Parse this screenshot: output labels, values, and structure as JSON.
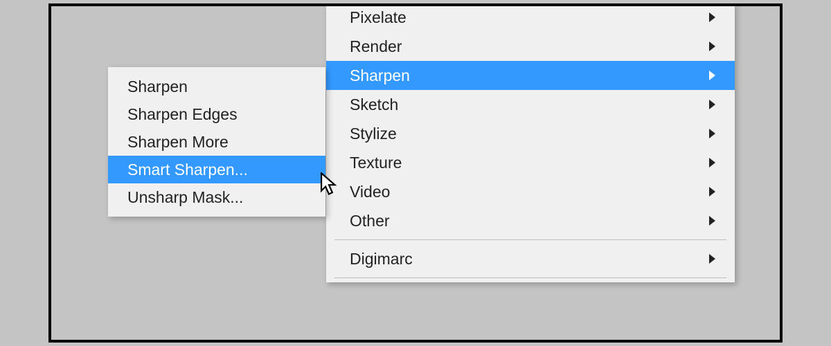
{
  "colors": {
    "highlight": "#3399ff"
  },
  "mainMenu": {
    "items": [
      {
        "label": "Pixelate",
        "hasSub": true
      },
      {
        "label": "Render",
        "hasSub": true
      },
      {
        "label": "Sharpen",
        "hasSub": true,
        "highlighted": true
      },
      {
        "label": "Sketch",
        "hasSub": true
      },
      {
        "label": "Stylize",
        "hasSub": true
      },
      {
        "label": "Texture",
        "hasSub": true
      },
      {
        "label": "Video",
        "hasSub": true
      },
      {
        "label": "Other",
        "hasSub": true
      }
    ],
    "afterSepItems": [
      {
        "label": "Digimarc",
        "hasSub": true
      }
    ]
  },
  "subMenu": {
    "items": [
      {
        "label": "Sharpen"
      },
      {
        "label": "Sharpen Edges"
      },
      {
        "label": "Sharpen More"
      },
      {
        "label": "Smart Sharpen...",
        "highlighted": true
      },
      {
        "label": "Unsharp Mask..."
      }
    ]
  }
}
